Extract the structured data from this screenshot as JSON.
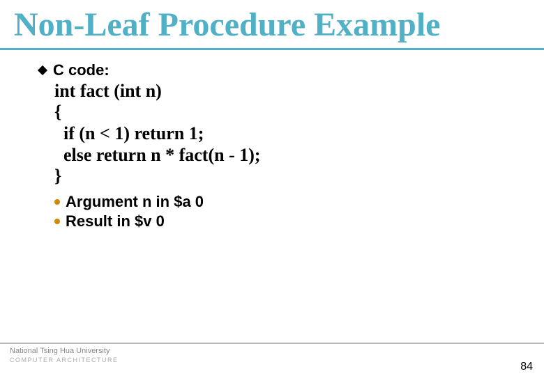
{
  "title": "Non-Leaf Procedure Example",
  "bullet": {
    "label": "C code:"
  },
  "code": "int fact (int n)\n{\n  if (n < 1) return 1;\n  else return n * fact(n - 1);\n}",
  "subs": [
    {
      "text": "Argument n in $a 0"
    },
    {
      "text": "Result in $v 0"
    }
  ],
  "footer": {
    "org": "National Tsing Hua University",
    "dept": "COMPUTER  ARCHITECTURE"
  },
  "page": "84"
}
